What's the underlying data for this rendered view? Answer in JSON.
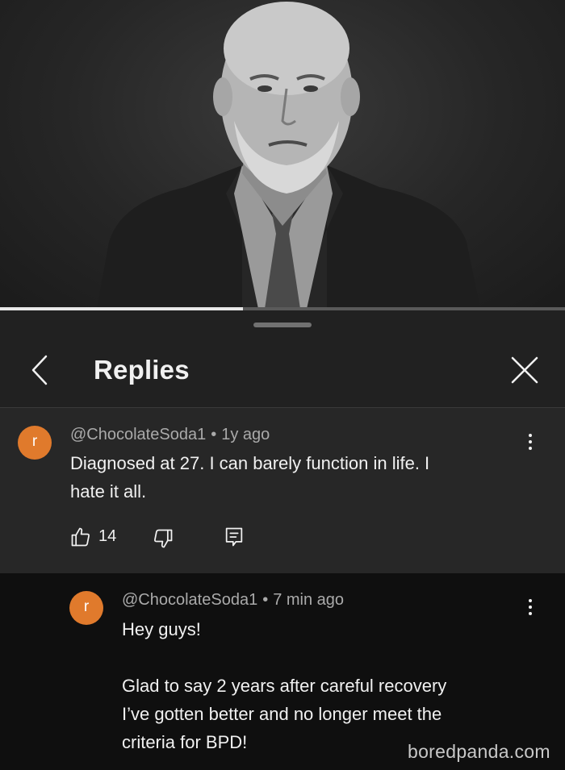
{
  "video": {
    "progress": 0.43
  },
  "sheet": {
    "title": "Replies"
  },
  "parent_comment": {
    "avatar_letter": "r",
    "author": "@ChocolateSoda1",
    "separator": "•",
    "time": "1y ago",
    "text": "Diagnosed at 27. I can barely function in life. I\nhate it all.",
    "like_count": "14"
  },
  "reply_comment": {
    "avatar_letter": "r",
    "author": "@ChocolateSoda1",
    "separator": "•",
    "time": "7 min ago",
    "text": "Hey guys!\n\nGlad to say 2 years after careful recovery\nI’ve gotten better and no longer meet the\ncriteria for BPD!"
  },
  "watermark": "boredpanda.com",
  "colors": {
    "avatar": "#e07a2c",
    "sheet_bg": "#212121",
    "parent_bg": "#272727",
    "reply_bg": "#0f0f0f"
  }
}
